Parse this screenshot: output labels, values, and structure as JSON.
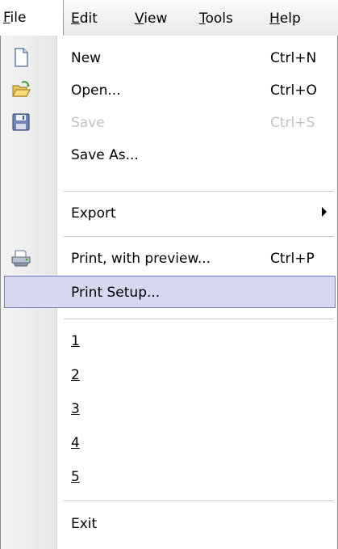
{
  "menubar": {
    "items": [
      {
        "label": "File",
        "mnemonic": "F"
      },
      {
        "label": "Edit",
        "mnemonic": "E"
      },
      {
        "label": "View",
        "mnemonic": "V"
      },
      {
        "label": "Tools",
        "mnemonic": "T"
      },
      {
        "label": "Help",
        "mnemonic": "H"
      }
    ]
  },
  "file_menu": {
    "new": {
      "label": "New",
      "shortcut": "Ctrl+N",
      "icon": "new-document-icon"
    },
    "open": {
      "label": "Open...",
      "shortcut": "Ctrl+O",
      "icon": "open-folder-icon"
    },
    "save": {
      "label": "Save",
      "shortcut": "Ctrl+S",
      "icon": "floppy-disk-icon",
      "disabled": true
    },
    "save_as": {
      "label": "Save As..."
    },
    "export": {
      "label": "Export",
      "has_submenu": true
    },
    "print_preview": {
      "label": "Print, with preview...",
      "shortcut": "Ctrl+P",
      "icon": "printer-icon"
    },
    "print_setup": {
      "label": "Print Setup...",
      "highlighted": true
    },
    "recent": [
      "1",
      "2",
      "3",
      "4",
      "5"
    ],
    "exit": {
      "label": "Exit"
    }
  },
  "colors": {
    "highlight_fill": "#d5d8ee",
    "highlight_border": "#7a7fba",
    "disabled_text": "#c2c2c2"
  }
}
